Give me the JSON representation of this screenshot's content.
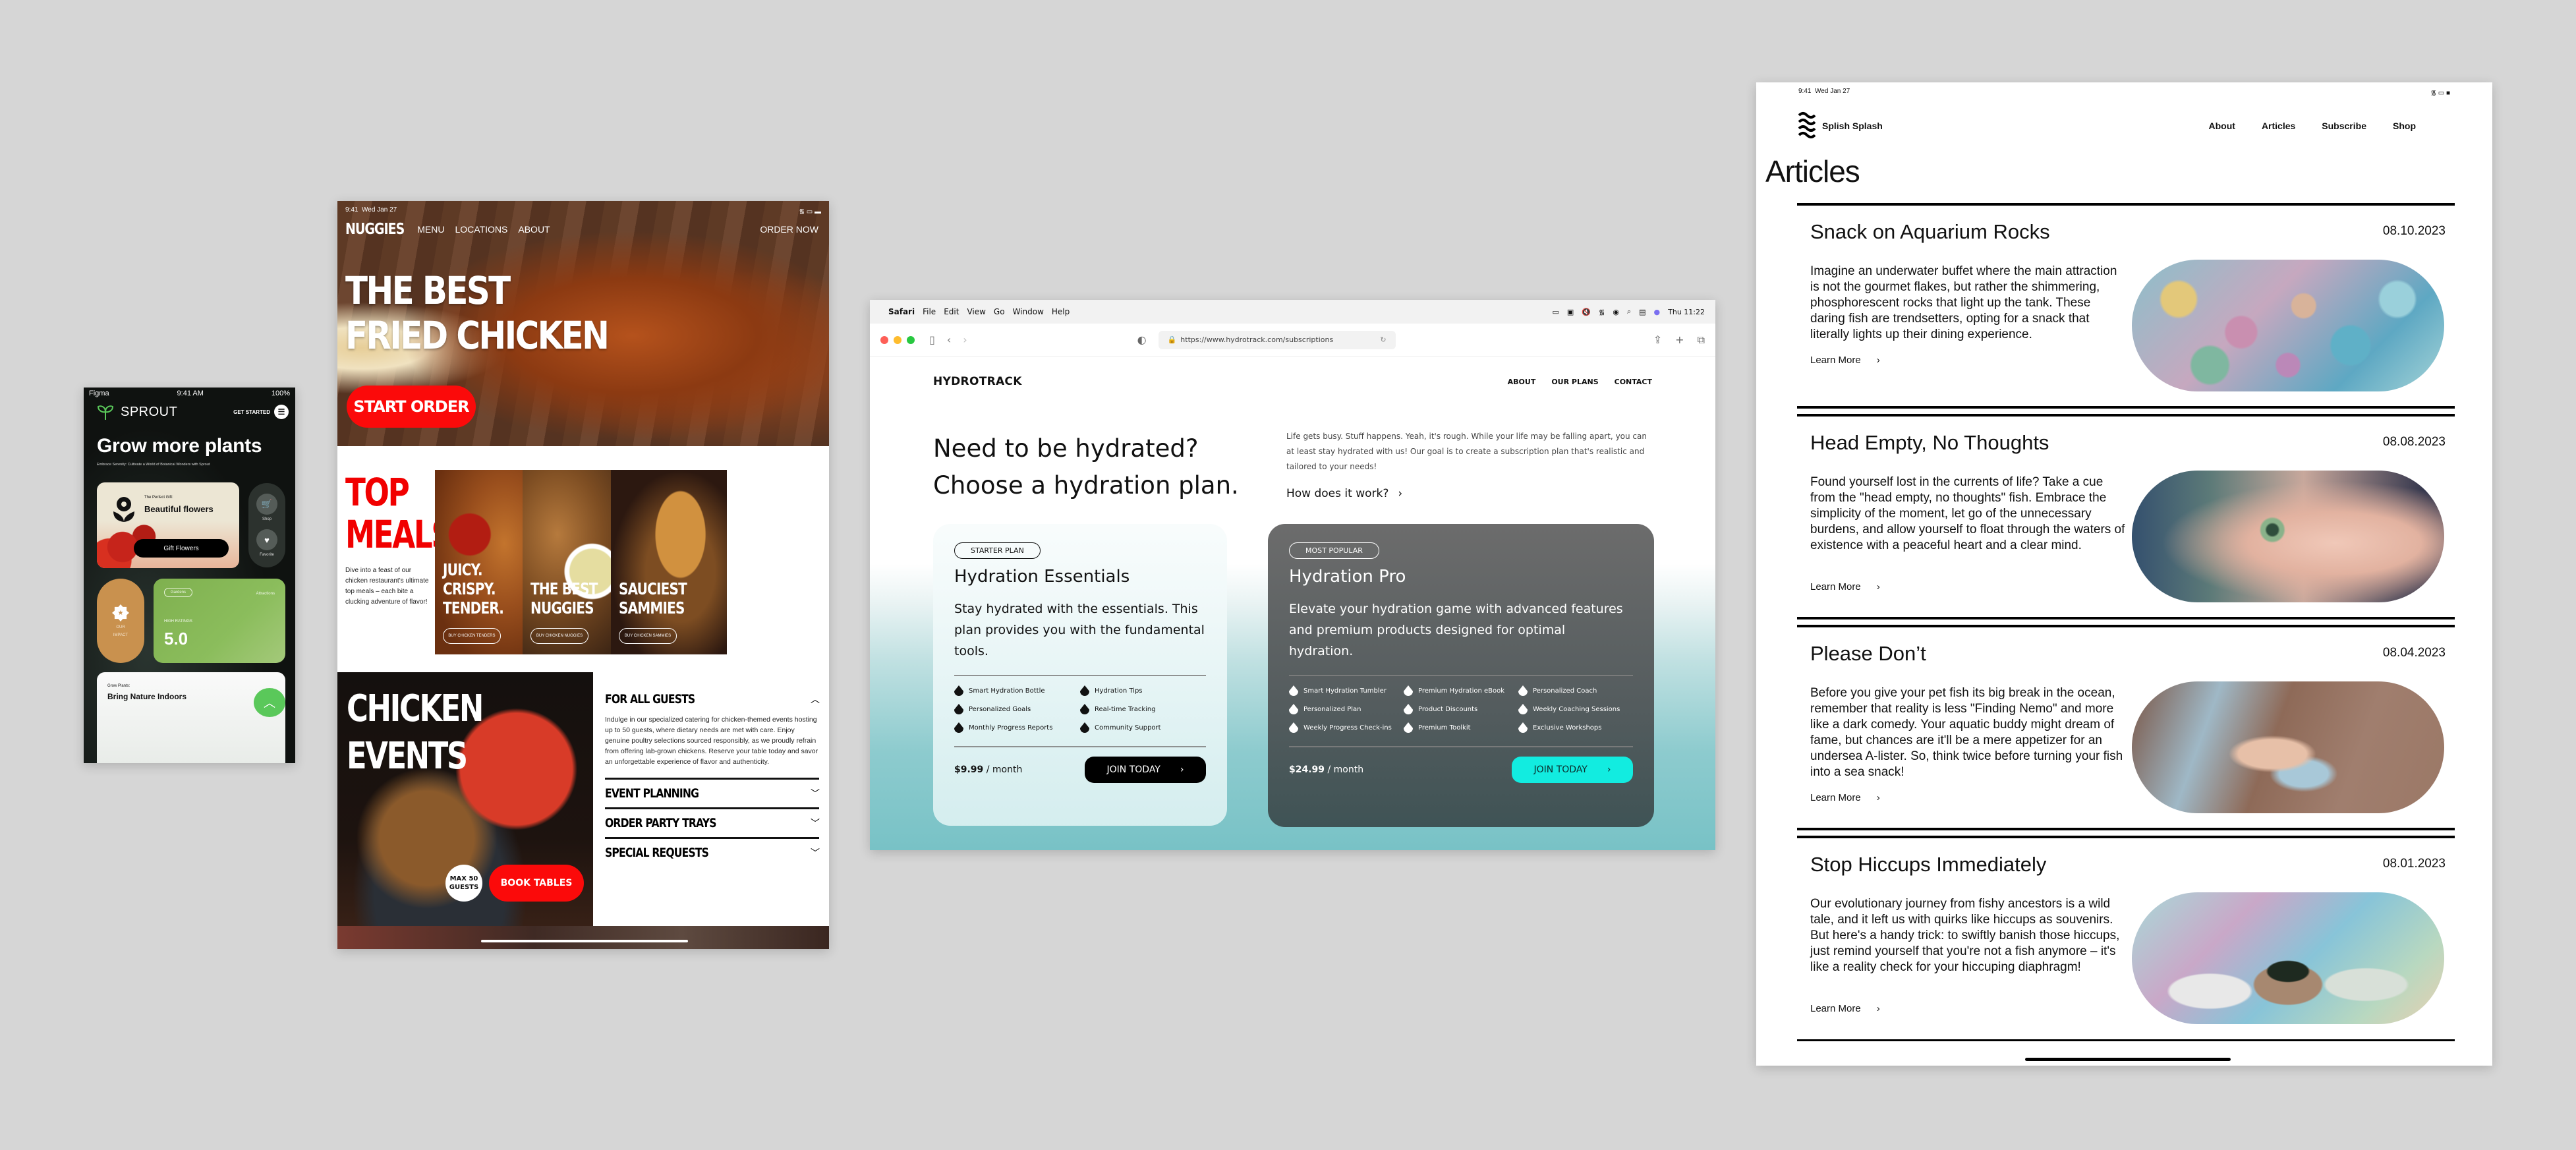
{
  "sprout": {
    "status": {
      "carrier": "Figma",
      "time": "9:41 AM",
      "battery": "100%"
    },
    "brand": "SPROUT",
    "get_started": "GET STARTED",
    "headline": "Grow more plants",
    "subheadline": "Embrace Serenity: Cultivate a World of Botanical Wonders with Sprout",
    "gift_card": {
      "eyebrow": "The Perfect Gift:",
      "title": "Beautiful flowers",
      "button": "Gift Flowers"
    },
    "side_actions": [
      {
        "label": "Shop",
        "icon": "cart-icon"
      },
      {
        "label": "Favorite",
        "icon": "heart-icon"
      }
    ],
    "impact": {
      "label_line1": "OUR",
      "label_line2": "IMPACT"
    },
    "ratings_card": {
      "chip": "Gardens",
      "right_label": "Attractions",
      "label": "HIGH RATINGS",
      "value": "5.0"
    },
    "indoor_card": {
      "eyebrow": "Grow Plants:",
      "title": "Bring Nature Indoors"
    },
    "accent": "#5ac85a"
  },
  "nuggies": {
    "status": {
      "time": "9:41",
      "date": "Wed Jan 27"
    },
    "brand": "NUGGIES",
    "nav": [
      "MENU",
      "LOCATIONS",
      "ABOUT"
    ],
    "order_now": "ORDER NOW",
    "hero_line1": "THE BEST",
    "hero_line2": "FRIED CHICKEN",
    "start_order": "START ORDER",
    "top_meals_line1": "TOP",
    "top_meals_line2": "MEALS",
    "top_meals_desc": "Dive into a feast of our chicken restaurant's ultimate top meals – each bite a clucking adventure of flavor!",
    "meals": [
      {
        "line1": "JUICY.",
        "line2": "CRISPY.",
        "line3": "TENDER.",
        "button": "BUY CHICKEN TENDERS"
      },
      {
        "line1": "THE BEST",
        "line2": "NUGGIES",
        "line3": "",
        "button": "BUY CHICKEN NUGGIES"
      },
      {
        "line1": "SAUCIEST",
        "line2": "SAMMIES",
        "line3": "",
        "button": "BUY CHICKEN SAMMIES"
      }
    ],
    "events_line1": "CHICKEN",
    "events_line2": "EVENTS",
    "max_guests_line1": "MAX 50",
    "max_guests_line2": "GUESTS",
    "book_tables": "BOOK TABLES",
    "accordion": [
      {
        "title": "FOR ALL GUESTS",
        "expanded": true,
        "body": "Indulge in our specialized catering for chicken-themed events hosting up to 50 guests, where dietary needs are met with care. Enjoy genuine poultry selections sourced responsibly, as we proudly refrain from offering lab-grown chickens. Reserve your table today and savor an unforgettable experience of flavor and authenticity."
      },
      {
        "title": "EVENT PLANNING",
        "expanded": false
      },
      {
        "title": "ORDER PARTY TRAYS",
        "expanded": false
      },
      {
        "title": "SPECIAL REQUESTS",
        "expanded": false
      }
    ],
    "accent": "#fb0a0a"
  },
  "hydrotrack": {
    "menubar": {
      "app": "Safari",
      "items": [
        "File",
        "Edit",
        "View",
        "Go",
        "Window",
        "Help"
      ],
      "clock": "Thu 11:22"
    },
    "url": "https://www.hydrotrack.com/subscriptions",
    "brand": "HYDROTRACK",
    "nav": [
      "ABOUT",
      "OUR PLANS",
      "CONTACT"
    ],
    "headline_line1": "Need to be hydrated?",
    "headline_line2": "Choose a hydration plan.",
    "intro": "Life gets busy. Stuff happens. Yeah, it's rough. While your life may be falling apart, you can at least stay hydrated with us! Our goal is to create a subscription plan that's realistic and tailored to your needs!",
    "how_link": "How does it work?",
    "plans": [
      {
        "tag": "STARTER PLAN",
        "name": "Hydration Essentials",
        "description": "Stay hydrated with the essentials. This plan provides you with the fundamental tools.",
        "features": [
          "Smart Hydration Bottle",
          "Hydration Tips",
          "Personalized Goals",
          "Real-time Tracking",
          "Monthly Progress Reports",
          "Community Support"
        ],
        "price": "$9.99",
        "period": "/ month",
        "cta": "JOIN TODAY"
      },
      {
        "tag": "MOST POPULAR",
        "name": "Hydration Pro",
        "description": "Elevate your hydration game with advanced features and premium products designed for optimal hydration.",
        "features": [
          "Smart Hydration Tumbler",
          "Premium Hydration eBook",
          "Personalized Coach",
          "Personalized Plan",
          "Product Discounts",
          "Weekly Coaching Sessions",
          "Weekly Progress Check-ins",
          "Premium Toolkit",
          "Exclusive Workshops"
        ],
        "price": "$24.99",
        "period": "/ month",
        "cta": "JOIN TODAY"
      }
    ],
    "accent": "#12ece0"
  },
  "splish": {
    "status": {
      "time": "9:41",
      "date": "Wed Jan 27"
    },
    "brand": "Splish Splash",
    "nav": [
      "About",
      "Articles",
      "Subscribe",
      "Shop"
    ],
    "page_title": "Articles",
    "learn_more": "Learn More",
    "articles": [
      {
        "title": "Snack on Aquarium Rocks",
        "date": "08.10.2023",
        "body": "Imagine an underwater buffet where the main attraction is not the gourmet flakes, but rather the shimmering, phosphorescent rocks that light up the tank. These daring fish are trendsetters, opting for a snack that literally lights up their dining experience."
      },
      {
        "title": "Head Empty, No Thoughts",
        "date": "08.08.2023",
        "body": "Found yourself lost in the currents of life? Take a cue from the \"head empty, no thoughts\" fish. Embrace the simplicity of the moment, let go of the unnecessary burdens, and allow yourself to float through the waters of existence with a peaceful heart and a clear mind."
      },
      {
        "title": "Please Don’t",
        "date": "08.04.2023",
        "body": "Before you give your pet fish its big break in the ocean, remember that reality is less \"Finding Nemo\" and more like a dark comedy. Your aquatic buddy might dream of fame, but chances are it'll be a mere appetizer for an undersea A-lister. So, think twice before turning your fish into a sea snack!"
      },
      {
        "title": "Stop Hiccups Immediately",
        "date": "08.01.2023",
        "body": "Our evolutionary journey from fishy ancestors is a wild tale, and it left us with quirks like hiccups as souvenirs. But here's a handy trick: to swiftly banish those hiccups, just remind yourself that you're not a fish anymore – it's like a reality check for your hiccuping diaphragm!"
      }
    ]
  }
}
